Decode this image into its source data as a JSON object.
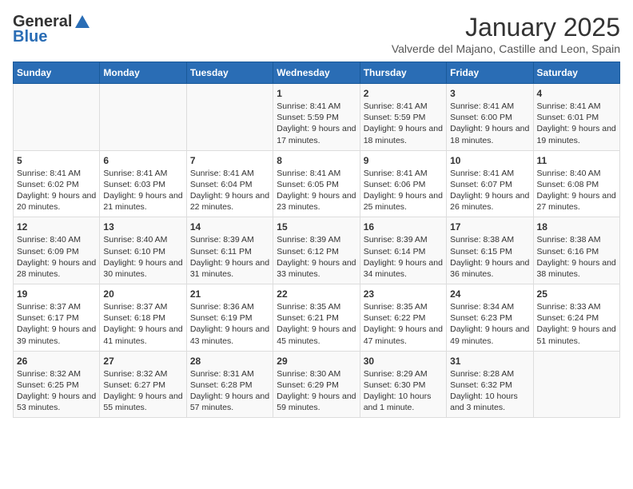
{
  "header": {
    "logo_line1": "General",
    "logo_line2": "Blue",
    "month": "January 2025",
    "location": "Valverde del Majano, Castille and Leon, Spain"
  },
  "days_of_week": [
    "Sunday",
    "Monday",
    "Tuesday",
    "Wednesday",
    "Thursday",
    "Friday",
    "Saturday"
  ],
  "weeks": [
    [
      {
        "day": "",
        "text": ""
      },
      {
        "day": "",
        "text": ""
      },
      {
        "day": "",
        "text": ""
      },
      {
        "day": "1",
        "text": "Sunrise: 8:41 AM\nSunset: 5:59 PM\nDaylight: 9 hours and 17 minutes."
      },
      {
        "day": "2",
        "text": "Sunrise: 8:41 AM\nSunset: 5:59 PM\nDaylight: 9 hours and 18 minutes."
      },
      {
        "day": "3",
        "text": "Sunrise: 8:41 AM\nSunset: 6:00 PM\nDaylight: 9 hours and 18 minutes."
      },
      {
        "day": "4",
        "text": "Sunrise: 8:41 AM\nSunset: 6:01 PM\nDaylight: 9 hours and 19 minutes."
      }
    ],
    [
      {
        "day": "5",
        "text": "Sunrise: 8:41 AM\nSunset: 6:02 PM\nDaylight: 9 hours and 20 minutes."
      },
      {
        "day": "6",
        "text": "Sunrise: 8:41 AM\nSunset: 6:03 PM\nDaylight: 9 hours and 21 minutes."
      },
      {
        "day": "7",
        "text": "Sunrise: 8:41 AM\nSunset: 6:04 PM\nDaylight: 9 hours and 22 minutes."
      },
      {
        "day": "8",
        "text": "Sunrise: 8:41 AM\nSunset: 6:05 PM\nDaylight: 9 hours and 23 minutes."
      },
      {
        "day": "9",
        "text": "Sunrise: 8:41 AM\nSunset: 6:06 PM\nDaylight: 9 hours and 25 minutes."
      },
      {
        "day": "10",
        "text": "Sunrise: 8:41 AM\nSunset: 6:07 PM\nDaylight: 9 hours and 26 minutes."
      },
      {
        "day": "11",
        "text": "Sunrise: 8:40 AM\nSunset: 6:08 PM\nDaylight: 9 hours and 27 minutes."
      }
    ],
    [
      {
        "day": "12",
        "text": "Sunrise: 8:40 AM\nSunset: 6:09 PM\nDaylight: 9 hours and 28 minutes."
      },
      {
        "day": "13",
        "text": "Sunrise: 8:40 AM\nSunset: 6:10 PM\nDaylight: 9 hours and 30 minutes."
      },
      {
        "day": "14",
        "text": "Sunrise: 8:39 AM\nSunset: 6:11 PM\nDaylight: 9 hours and 31 minutes."
      },
      {
        "day": "15",
        "text": "Sunrise: 8:39 AM\nSunset: 6:12 PM\nDaylight: 9 hours and 33 minutes."
      },
      {
        "day": "16",
        "text": "Sunrise: 8:39 AM\nSunset: 6:14 PM\nDaylight: 9 hours and 34 minutes."
      },
      {
        "day": "17",
        "text": "Sunrise: 8:38 AM\nSunset: 6:15 PM\nDaylight: 9 hours and 36 minutes."
      },
      {
        "day": "18",
        "text": "Sunrise: 8:38 AM\nSunset: 6:16 PM\nDaylight: 9 hours and 38 minutes."
      }
    ],
    [
      {
        "day": "19",
        "text": "Sunrise: 8:37 AM\nSunset: 6:17 PM\nDaylight: 9 hours and 39 minutes."
      },
      {
        "day": "20",
        "text": "Sunrise: 8:37 AM\nSunset: 6:18 PM\nDaylight: 9 hours and 41 minutes."
      },
      {
        "day": "21",
        "text": "Sunrise: 8:36 AM\nSunset: 6:19 PM\nDaylight: 9 hours and 43 minutes."
      },
      {
        "day": "22",
        "text": "Sunrise: 8:35 AM\nSunset: 6:21 PM\nDaylight: 9 hours and 45 minutes."
      },
      {
        "day": "23",
        "text": "Sunrise: 8:35 AM\nSunset: 6:22 PM\nDaylight: 9 hours and 47 minutes."
      },
      {
        "day": "24",
        "text": "Sunrise: 8:34 AM\nSunset: 6:23 PM\nDaylight: 9 hours and 49 minutes."
      },
      {
        "day": "25",
        "text": "Sunrise: 8:33 AM\nSunset: 6:24 PM\nDaylight: 9 hours and 51 minutes."
      }
    ],
    [
      {
        "day": "26",
        "text": "Sunrise: 8:32 AM\nSunset: 6:25 PM\nDaylight: 9 hours and 53 minutes."
      },
      {
        "day": "27",
        "text": "Sunrise: 8:32 AM\nSunset: 6:27 PM\nDaylight: 9 hours and 55 minutes."
      },
      {
        "day": "28",
        "text": "Sunrise: 8:31 AM\nSunset: 6:28 PM\nDaylight: 9 hours and 57 minutes."
      },
      {
        "day": "29",
        "text": "Sunrise: 8:30 AM\nSunset: 6:29 PM\nDaylight: 9 hours and 59 minutes."
      },
      {
        "day": "30",
        "text": "Sunrise: 8:29 AM\nSunset: 6:30 PM\nDaylight: 10 hours and 1 minute."
      },
      {
        "day": "31",
        "text": "Sunrise: 8:28 AM\nSunset: 6:32 PM\nDaylight: 10 hours and 3 minutes."
      },
      {
        "day": "",
        "text": ""
      }
    ]
  ]
}
